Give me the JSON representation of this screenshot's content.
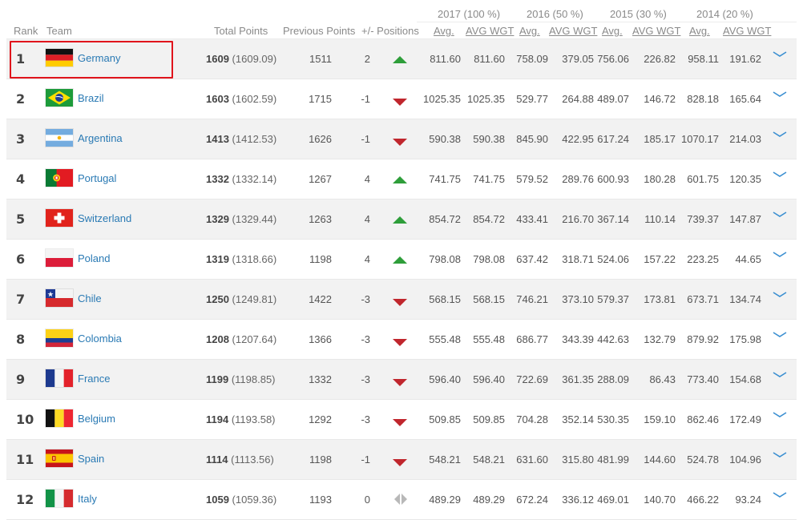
{
  "header": {
    "years": [
      "2017 (100 %)",
      "2016 (50 %)",
      "2015 (30 %)",
      "2014 (20 %)"
    ],
    "rank": "Rank",
    "team": "Team",
    "total_points": "Total Points",
    "previous_points": "Previous Points",
    "plus_minus": "+/- Positions",
    "avg": "Avg.",
    "avg_wgt": "AVG WGT"
  },
  "colors": {
    "up": "#2e9e3a",
    "down": "#c0262d",
    "link": "#2a7ab4",
    "highlight": "#e0141c"
  },
  "rows": [
    {
      "rank": "1",
      "team": "Germany",
      "flag": "germany-flag",
      "total": "1609",
      "total_exact": "(1609.09)",
      "prev": "1511",
      "change": "2",
      "trend": "up",
      "vals": [
        "811.60",
        "811.60",
        "758.09",
        "379.05",
        "756.06",
        "226.82",
        "958.11",
        "191.62"
      ]
    },
    {
      "rank": "2",
      "team": "Brazil",
      "flag": "brazil-flag",
      "total": "1603",
      "total_exact": "(1602.59)",
      "prev": "1715",
      "change": "-1",
      "trend": "down",
      "vals": [
        "1025.35",
        "1025.35",
        "529.77",
        "264.88",
        "489.07",
        "146.72",
        "828.18",
        "165.64"
      ]
    },
    {
      "rank": "3",
      "team": "Argentina",
      "flag": "argentina-flag",
      "total": "1413",
      "total_exact": "(1412.53)",
      "prev": "1626",
      "change": "-1",
      "trend": "down",
      "vals": [
        "590.38",
        "590.38",
        "845.90",
        "422.95",
        "617.24",
        "185.17",
        "1070.17",
        "214.03"
      ]
    },
    {
      "rank": "4",
      "team": "Portugal",
      "flag": "portugal-flag",
      "total": "1332",
      "total_exact": "(1332.14)",
      "prev": "1267",
      "change": "4",
      "trend": "up",
      "vals": [
        "741.75",
        "741.75",
        "579.52",
        "289.76",
        "600.93",
        "180.28",
        "601.75",
        "120.35"
      ]
    },
    {
      "rank": "5",
      "team": "Switzerland",
      "flag": "switzerland-flag",
      "total": "1329",
      "total_exact": "(1329.44)",
      "prev": "1263",
      "change": "4",
      "trend": "up",
      "vals": [
        "854.72",
        "854.72",
        "433.41",
        "216.70",
        "367.14",
        "110.14",
        "739.37",
        "147.87"
      ]
    },
    {
      "rank": "6",
      "team": "Poland",
      "flag": "poland-flag",
      "total": "1319",
      "total_exact": "(1318.66)",
      "prev": "1198",
      "change": "4",
      "trend": "up",
      "vals": [
        "798.08",
        "798.08",
        "637.42",
        "318.71",
        "524.06",
        "157.22",
        "223.25",
        "44.65"
      ]
    },
    {
      "rank": "7",
      "team": "Chile",
      "flag": "chile-flag",
      "total": "1250",
      "total_exact": "(1249.81)",
      "prev": "1422",
      "change": "-3",
      "trend": "down",
      "vals": [
        "568.15",
        "568.15",
        "746.21",
        "373.10",
        "579.37",
        "173.81",
        "673.71",
        "134.74"
      ]
    },
    {
      "rank": "8",
      "team": "Colombia",
      "flag": "colombia-flag",
      "total": "1208",
      "total_exact": "(1207.64)",
      "prev": "1366",
      "change": "-3",
      "trend": "down",
      "vals": [
        "555.48",
        "555.48",
        "686.77",
        "343.39",
        "442.63",
        "132.79",
        "879.92",
        "175.98"
      ]
    },
    {
      "rank": "9",
      "team": "France",
      "flag": "france-flag",
      "total": "1199",
      "total_exact": "(1198.85)",
      "prev": "1332",
      "change": "-3",
      "trend": "down",
      "vals": [
        "596.40",
        "596.40",
        "722.69",
        "361.35",
        "288.09",
        "86.43",
        "773.40",
        "154.68"
      ]
    },
    {
      "rank": "10",
      "team": "Belgium",
      "flag": "belgium-flag",
      "total": "1194",
      "total_exact": "(1193.58)",
      "prev": "1292",
      "change": "-3",
      "trend": "down",
      "vals": [
        "509.85",
        "509.85",
        "704.28",
        "352.14",
        "530.35",
        "159.10",
        "862.46",
        "172.49"
      ]
    },
    {
      "rank": "11",
      "team": "Spain",
      "flag": "spain-flag",
      "total": "1114",
      "total_exact": "(1113.56)",
      "prev": "1198",
      "change": "-1",
      "trend": "down",
      "vals": [
        "548.21",
        "548.21",
        "631.60",
        "315.80",
        "481.99",
        "144.60",
        "524.78",
        "104.96"
      ]
    },
    {
      "rank": "12",
      "team": "Italy",
      "flag": "italy-flag",
      "total": "1059",
      "total_exact": "(1059.36)",
      "prev": "1193",
      "change": "0",
      "trend": "same",
      "vals": [
        "489.29",
        "489.29",
        "672.24",
        "336.12",
        "469.01",
        "140.70",
        "466.22",
        "93.24"
      ]
    }
  ]
}
